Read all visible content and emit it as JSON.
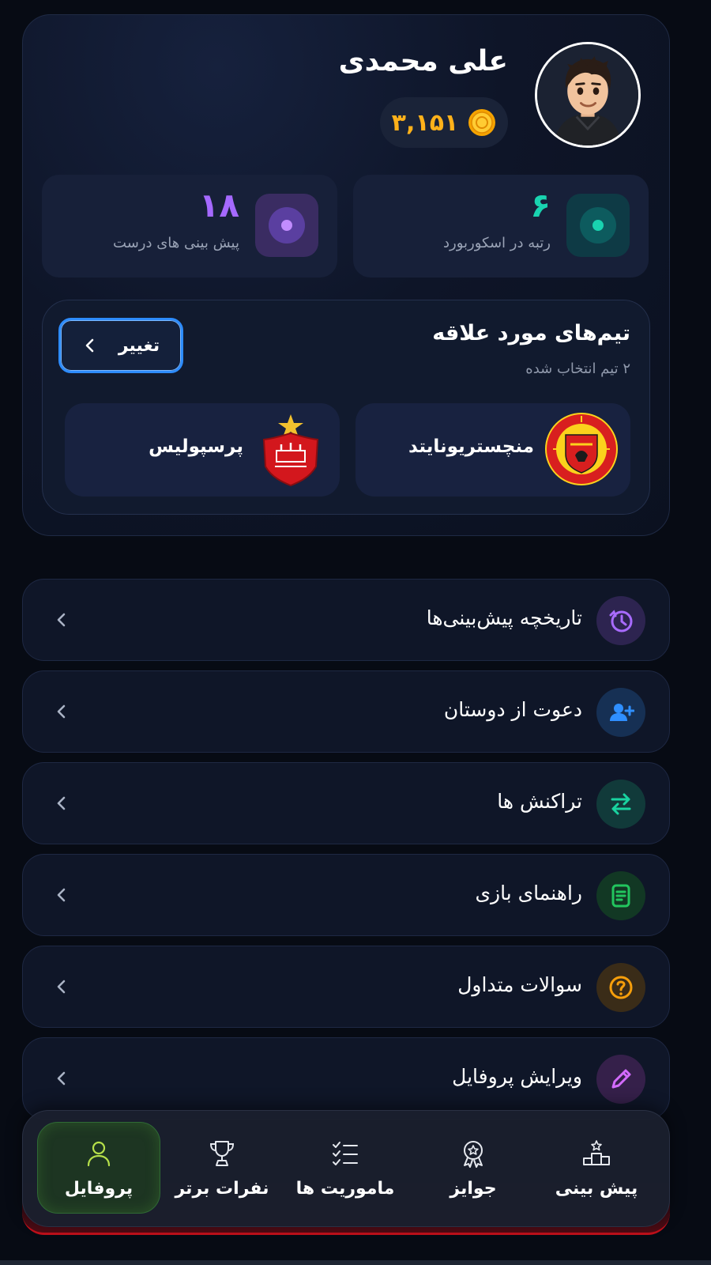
{
  "profile": {
    "name": "علی محمدی",
    "coins": "۳,۱۵۱",
    "avatar_icon": "user-avatar",
    "coin_icon": "gold-coin-icon",
    "stats": [
      {
        "id": "rank",
        "value": "۶",
        "label": "رتبه در اسکوربورد",
        "color": "#19d3b0"
      },
      {
        "id": "correct",
        "value": "۱۸",
        "label": "پیش بینی های درست",
        "color": "#a569ff"
      }
    ]
  },
  "favorite_teams": {
    "title": "تیم‌های مورد علاقه",
    "subtitle": "۲ تیم انتخاب شده",
    "change_label": "تغییر",
    "teams": [
      {
        "name": "منچستریونایتد",
        "logo": "manchester-united-logo"
      },
      {
        "name": "پرسپولیس",
        "logo": "persepolis-logo"
      }
    ]
  },
  "menu": [
    {
      "label": "تاریخچه پیش‌بینی‌ها",
      "icon": "history-icon",
      "color": "#a86bff"
    },
    {
      "label": "دعوت از دوستان",
      "icon": "add-user-icon",
      "color": "#2f8fff"
    },
    {
      "label": "تراکنش ها",
      "icon": "swap-arrows-icon",
      "color": "#19d3a0"
    },
    {
      "label": "راهنمای بازی",
      "icon": "document-icon",
      "color": "#22c55e"
    },
    {
      "label": "سوالات متداول",
      "icon": "question-icon",
      "color": "#f59e0b"
    },
    {
      "label": "ویرایش پروفایل",
      "icon": "pencil-icon",
      "color": "#d36bff"
    }
  ],
  "bottom_nav": [
    {
      "label": "پیش بینی",
      "icon": "podium-icon",
      "active": false
    },
    {
      "label": "جوایز",
      "icon": "medal-icon",
      "active": false
    },
    {
      "label": "ماموریت ها",
      "icon": "checklist-icon",
      "active": false
    },
    {
      "label": "نفرات برتر",
      "icon": "trophy-icon",
      "active": false
    },
    {
      "label": "پروفایل",
      "icon": "person-icon",
      "active": true
    }
  ],
  "colors": {
    "background": "#070b14",
    "active_nav": "#1d3522",
    "accent_blue": "#2d8cff",
    "coin_gold": "#ffb11a"
  }
}
